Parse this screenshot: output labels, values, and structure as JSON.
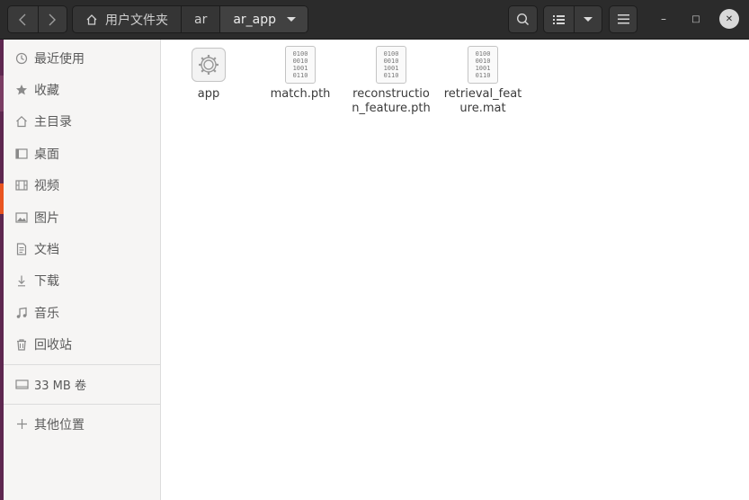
{
  "header": {
    "back_icon": "chevron-left-icon",
    "forward_icon": "chevron-right-icon",
    "breadcrumb": [
      {
        "label": "用户文件夹",
        "icon": "home-icon"
      },
      {
        "label": "ar"
      },
      {
        "label": "ar_app"
      }
    ],
    "minimize_label": "–",
    "maximize_label": "□",
    "close_label": "✕"
  },
  "sidebar": {
    "items": [
      {
        "label": "最近使用",
        "icon": "clock-icon"
      },
      {
        "label": "收藏",
        "icon": "star-icon"
      },
      {
        "label": "主目录",
        "icon": "home-icon"
      },
      {
        "label": "桌面",
        "icon": "desktop-icon"
      },
      {
        "label": "视频",
        "icon": "film-icon"
      },
      {
        "label": "图片",
        "icon": "image-icon"
      },
      {
        "label": "文档",
        "icon": "document-icon"
      },
      {
        "label": "下载",
        "icon": "download-icon"
      },
      {
        "label": "音乐",
        "icon": "music-icon"
      },
      {
        "label": "回收站",
        "icon": "trash-icon"
      }
    ],
    "volume": {
      "label": "33 MB 卷",
      "icon": "drive-icon"
    },
    "other": {
      "label": "其他位置",
      "icon": "plus-icon"
    }
  },
  "files": [
    {
      "name": "app",
      "type": "executable"
    },
    {
      "name": "match.pth",
      "type": "binary"
    },
    {
      "name": "reconstruction_feature.pth",
      "type": "binary"
    },
    {
      "name": "retrieval_feature.mat",
      "type": "binary"
    }
  ],
  "binary_glyph": "0100\n0010\n1001\n0110"
}
